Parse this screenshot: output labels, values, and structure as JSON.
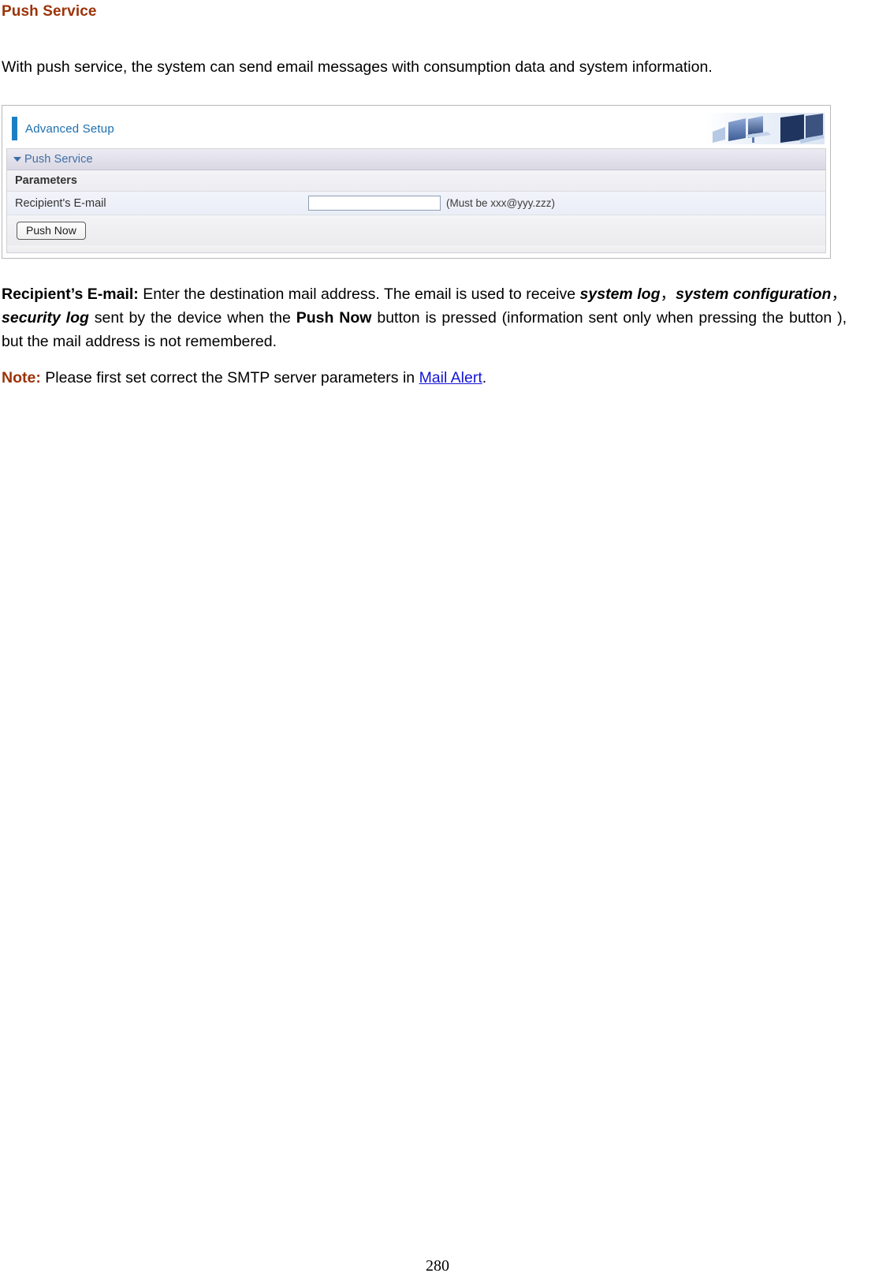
{
  "document": {
    "title": "Push Service",
    "title_color": "#9C3309",
    "page_number": "280"
  },
  "intro": {
    "text": "With push service, the system can send email messages with consumption data and system information."
  },
  "ui_screenshot": {
    "header": {
      "title": "Advanced Setup",
      "accent_color": "#1b7fc4",
      "title_color": "#1b6fae",
      "art_name": "office-laptops-banner"
    },
    "section": {
      "label": "Push Service",
      "expanded_icon": "triangle-down-icon"
    },
    "parameters_label": "Parameters",
    "field": {
      "label": "Recipient's E-mail",
      "value": "",
      "placeholder": "",
      "hint": "(Must be xxx@yyy.zzz)"
    },
    "button": {
      "label": "Push Now"
    }
  },
  "description": {
    "term": "Recipient’s E-mail:",
    "part1": " Enter the destination mail address. The email is used to receive ",
    "em1": "system log",
    "sep1": "，",
    "em2": "system configuration",
    "sep2": "，",
    "em3": "security log",
    "part2": " sent by the device when the ",
    "strong1": "Push Now",
    "part3": " button is pressed (information sent only when pressing the button ), but the mail address is not remembered."
  },
  "note": {
    "label": "Note:",
    "label_color": "#9C3309",
    "text_before": " Please first set correct the SMTP server parameters in ",
    "link_text": "Mail Alert",
    "link_color": "#1414d6",
    "text_after": "."
  }
}
